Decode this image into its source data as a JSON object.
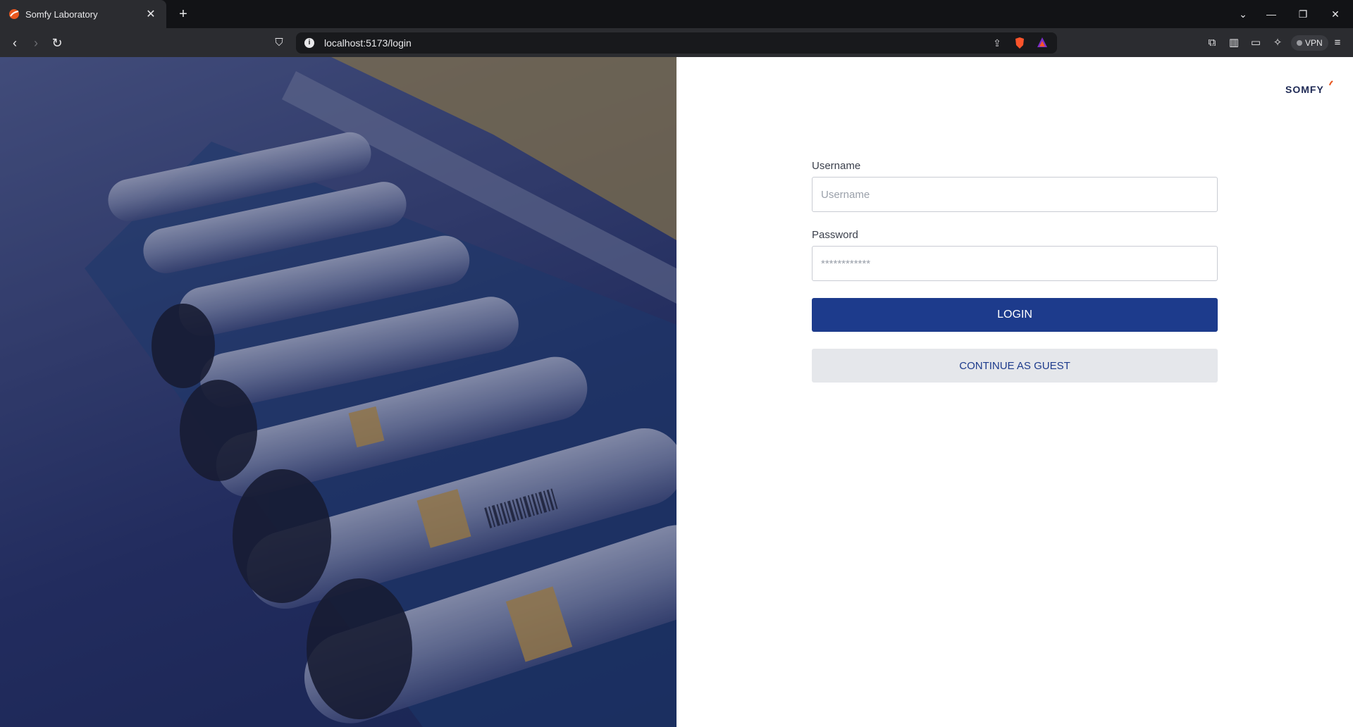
{
  "browser": {
    "tab": {
      "title": "Somfy Laboratory",
      "close_icon": "close-icon"
    },
    "new_tab_label": "+",
    "window_controls": [
      "chevron-down-icon",
      "minimize-icon",
      "restore-icon",
      "close-icon"
    ],
    "address": "localhost:5173/login",
    "vpn_label": "VPN",
    "nav_icons": [
      "back-icon",
      "forward-icon",
      "reload-icon"
    ]
  },
  "page": {
    "logo_text": "SOMFY",
    "username": {
      "label": "Username",
      "placeholder": "Username",
      "value": ""
    },
    "password": {
      "label": "Password",
      "placeholder": "************",
      "value": ""
    },
    "login_label": "LOGIN",
    "guest_label": "CONTINUE AS GUEST",
    "colors": {
      "primary": "#1d3b8c",
      "guest_bg": "#e5e7eb",
      "logo": "#1f2a55",
      "brand_accent": "#e8571f"
    }
  }
}
